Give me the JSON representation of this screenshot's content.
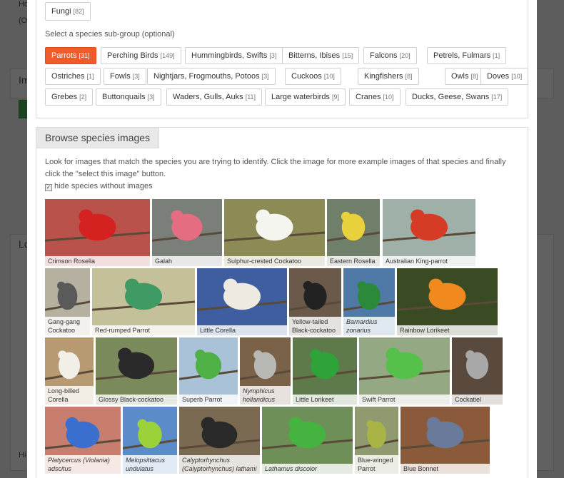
{
  "background": {
    "text_hc": "Ho",
    "text_o": "(O",
    "text_im": "Im",
    "text_lo": "Lo",
    "text_hi": "Hi"
  },
  "top": {
    "kingdom_button": {
      "label": "Fungi",
      "count": "[82]"
    }
  },
  "subgroup": {
    "prompt": "Select a species sub-group (optional)",
    "rows": [
      [
        {
          "label": "Parrots",
          "count": "[31]",
          "active": true
        },
        {
          "label": "Perching Birds",
          "count": "[149]"
        },
        {
          "label": "Hummingbirds, Swifts",
          "count": "[3]"
        },
        {
          "label": "Bitterns, Ibises",
          "count": "[15]"
        },
        {
          "label": "Falcons",
          "count": "[20]"
        },
        {
          "label": "Petrels, Fulmars",
          "count": "[1]"
        }
      ],
      [
        {
          "label": "Ostriches",
          "count": "[1]"
        },
        {
          "label": "Fowls",
          "count": "[3]"
        },
        {
          "label": "Nightjars, Frogmouths, Potoos",
          "count": "[3]"
        },
        {
          "label": "Cuckoos",
          "count": "[10]"
        },
        {
          "label": "Kingfishers",
          "count": "[8]"
        },
        {
          "label": "Owls",
          "count": "[8]"
        },
        {
          "label": "Doves",
          "count": "[10]"
        }
      ],
      [
        {
          "label": "Grebes",
          "count": "[2]"
        },
        {
          "label": "Buttonquails",
          "count": "[3]"
        },
        {
          "label": "Waders, Gulls, Auks",
          "count": "[11]"
        },
        {
          "label": "Large waterbirds",
          "count": "[9]"
        },
        {
          "label": "Cranes",
          "count": "[10]"
        },
        {
          "label": "Ducks, Geese, Swans",
          "count": "[17]"
        }
      ]
    ]
  },
  "browse": {
    "title": "Browse species images",
    "instructions": "Look for images that match the species you are trying to identify. Click the image for more example images of that species and finally click the \"select this image\" button.",
    "hide_checkbox_label": "hide species without images",
    "hide_checked": true
  },
  "species_rows": [
    [
      {
        "name": "Crimson Rosella",
        "bg": "#b8524a",
        "bird": "#d62121"
      },
      {
        "name": "Galah",
        "bg": "#7a7f7a",
        "bird": "#e46d82"
      },
      {
        "name": "Sulphur-crested Cockatoo",
        "bg": "#8c8a55",
        "bird": "#f5f5ef"
      },
      {
        "name": "Eastern Rosella",
        "bg": "#6f7f6a",
        "bird": "#e8d13a"
      },
      {
        "name": "Australian King-parrot",
        "bg": "#9fb0a8",
        "bird": "#d63b26"
      }
    ],
    [
      {
        "name": "Gang-gang Cockatoo",
        "bg": "#b6b0a0",
        "bird": "#5a5a5a"
      },
      {
        "name": "Red-rumped Parrot",
        "bg": "#c4c09a",
        "bird": "#3f9a64"
      },
      {
        "name": "Little Corella",
        "bg": "#3f5ea0",
        "bird": "#eeeae2"
      },
      {
        "name": "Yellow-tailed Black-cockatoo",
        "bg": "#6b5a49",
        "bird": "#222222"
      },
      {
        "name": "Barnardius zonarius",
        "italic": true,
        "bg": "#4f7aa8",
        "bird": "#2b8a3a"
      },
      {
        "name": "Rainbow Lorikeet",
        "bg": "#3a4a22",
        "bird": "#f08a1e"
      }
    ],
    [
      {
        "name": "Long-billed Corella",
        "bg": "#b89a72",
        "bird": "#f2efe8"
      },
      {
        "name": "Glossy Black-cockatoo",
        "bg": "#7b8a5a",
        "bird": "#2a2a2a"
      },
      {
        "name": "Superb Parrot",
        "bg": "#a9c2d8",
        "bird": "#4fb046"
      },
      {
        "name": "Nymphicus hollandicus",
        "italic": true,
        "bg": "#7a6248",
        "bird": "#b8b8b4"
      },
      {
        "name": "Little Lorikeet",
        "bg": "#5e7a4a",
        "bird": "#2ea33a"
      },
      {
        "name": "Swift Parrot",
        "bg": "#94a883",
        "bird": "#55c04a"
      },
      {
        "name": "Cockatiel",
        "bg": "#5a4a3e",
        "bird": "#a8a8a8"
      }
    ],
    [
      {
        "name": "Platycercus (Violania) adscitus",
        "italic": true,
        "bg": "#c77e6e",
        "bird": "#3a6fd0"
      },
      {
        "name": "Melopsittacus undulatus",
        "italic": true,
        "bg": "#5b8cc9",
        "bird": "#9bd23a"
      },
      {
        "name": "Calyptorhynchus (Calyptorhynchus) lathami",
        "italic": true,
        "bg": "#7a6a52",
        "bird": "#2a2a2a"
      },
      {
        "name": "Lathamus discolor",
        "italic": true,
        "bg": "#6f8f58",
        "bird": "#45b340"
      },
      {
        "name": "Blue-winged Parrot",
        "bg": "#8f9a70",
        "bird": "#a8b445"
      },
      {
        "name": "Blue Bonnet",
        "bg": "#8a5a3a",
        "bird": "#6a7a9a"
      }
    ]
  ]
}
